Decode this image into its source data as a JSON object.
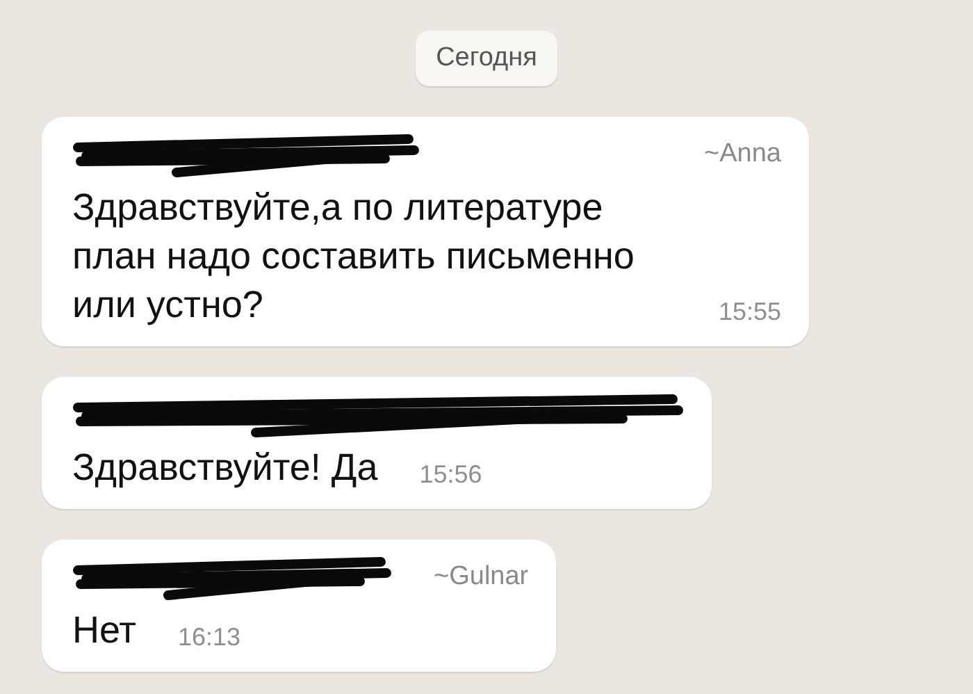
{
  "date_chip": "Сегодня",
  "messages": [
    {
      "sender_scribbled": true,
      "push_name": "~Anna",
      "text": "Здравствуйте,а по литературе план надо составить письменно или устно?",
      "time": "15:55"
    },
    {
      "sender_scribbled": true,
      "text": "Здравствуйте! Да",
      "time": "15:56"
    },
    {
      "sender_scribbled": true,
      "push_name": "~Gulnar",
      "text": "Нет",
      "time": "16:13"
    }
  ]
}
